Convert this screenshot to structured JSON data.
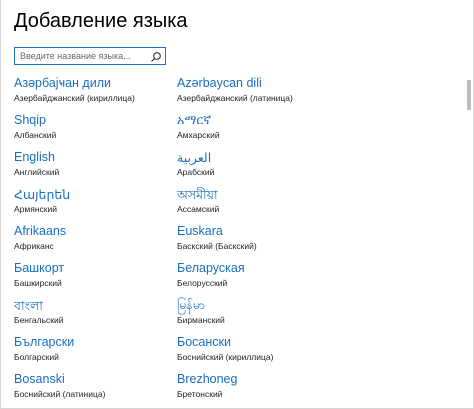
{
  "window": {
    "title": "Добавление языка"
  },
  "search": {
    "placeholder": "Введите название языка..."
  },
  "languages": [
    {
      "native": "Азәрбајҹан дили",
      "localized": "Азербайджанский (кириллица)"
    },
    {
      "native": "Azərbaycan dili",
      "localized": "Азербайджанский (латиница)"
    },
    {
      "native": "Shqip",
      "localized": "Албанский"
    },
    {
      "native": "አማርኛ",
      "localized": "Амхарский"
    },
    {
      "native": "English",
      "localized": "Английский"
    },
    {
      "native": "العربية",
      "localized": "Арабский"
    },
    {
      "native": "Հայերեն",
      "localized": "Армянский"
    },
    {
      "native": "অসমীয়া",
      "localized": "Ассамский"
    },
    {
      "native": "Afrikaans",
      "localized": "Африканс"
    },
    {
      "native": "Euskara",
      "localized": "Баскский (Баскский)"
    },
    {
      "native": "Башкорт",
      "localized": "Башкирский"
    },
    {
      "native": "Беларуская",
      "localized": "Белорусский"
    },
    {
      "native": "বাংলা",
      "localized": "Бенгальский"
    },
    {
      "native": "မြန်မာ",
      "localized": "Бирманский"
    },
    {
      "native": "Български",
      "localized": "Болгарский"
    },
    {
      "native": "Босански",
      "localized": "Боснийский (кириллица)"
    },
    {
      "native": "Bosanski",
      "localized": "Боснийский (латиница)"
    },
    {
      "native": "Brezhoneg",
      "localized": "Бретонский"
    }
  ]
}
